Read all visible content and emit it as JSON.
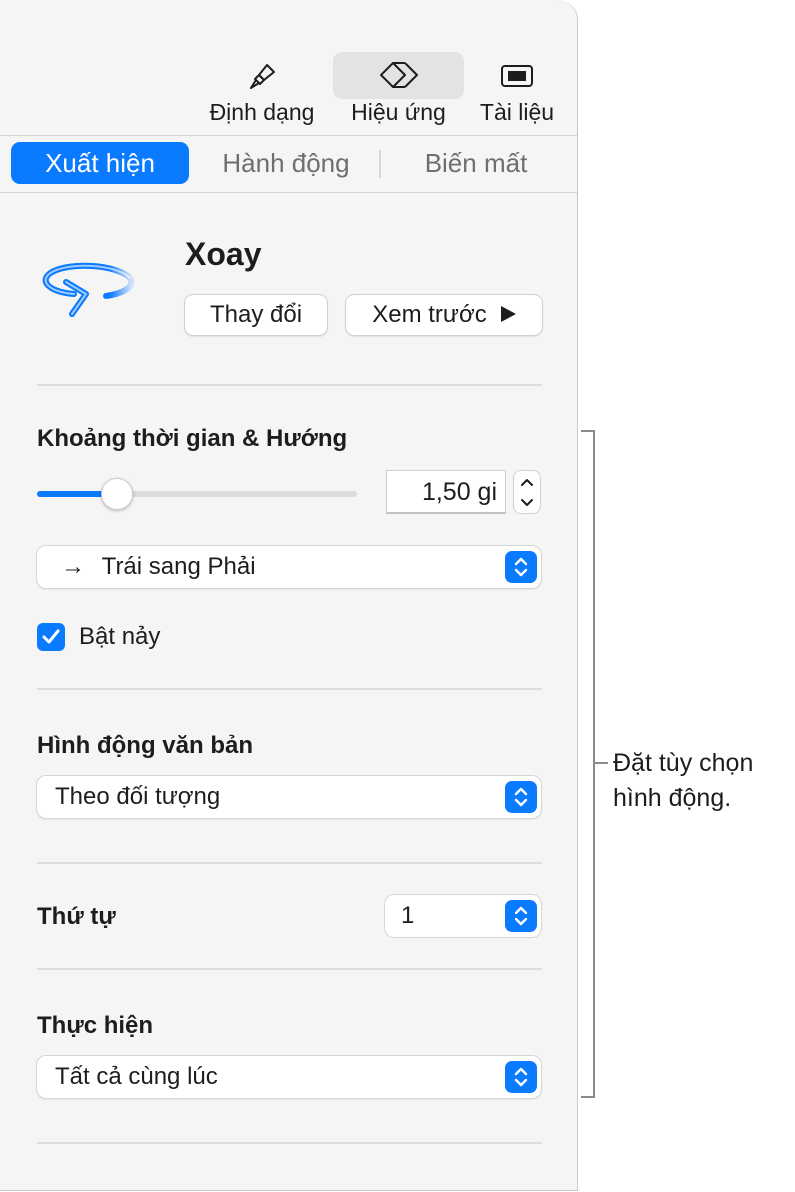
{
  "toolbar": {
    "items": [
      {
        "label": "Định dạng",
        "icon": "paintbrush-icon"
      },
      {
        "label": "Hiệu ứng",
        "icon": "diamond-icon",
        "active": true
      },
      {
        "label": "Tài liệu",
        "icon": "document-icon"
      }
    ]
  },
  "tabs": [
    {
      "label": "Xuất hiện",
      "active": true
    },
    {
      "label": "Hành động"
    },
    {
      "label": "Biến mất"
    }
  ],
  "effect": {
    "name": "Xoay",
    "icon": "rotate-arrow-icon",
    "change_label": "Thay đổi",
    "preview_label": "Xem trước"
  },
  "duration": {
    "title": "Khoảng thời gian & Hướng",
    "value": "1,50 gi",
    "slider_fraction": 0.25
  },
  "direction": {
    "arrow": "→",
    "value": "Trái sang Phải"
  },
  "bounce": {
    "label": "Bật nảy",
    "checked": true
  },
  "text_animation": {
    "title": "Hình động văn bản",
    "value": "Theo đối tượng"
  },
  "order": {
    "title": "Thứ tự",
    "value": "1"
  },
  "perform": {
    "title": "Thực hiện",
    "value": "Tất cả cùng lúc"
  },
  "callout": {
    "line1": "Đặt tùy chọn",
    "line2": "hình động."
  },
  "colors": {
    "accent": "#0a7aff",
    "panel_bg": "#f5f5f5"
  }
}
